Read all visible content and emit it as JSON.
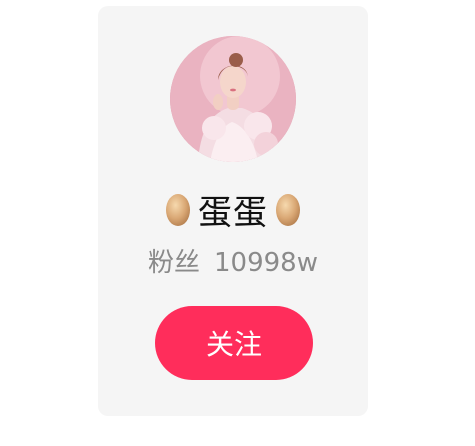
{
  "profile": {
    "name": "蛋蛋",
    "fans_label": "粉丝",
    "fans_count": "10998w",
    "avatar_icon": "user-avatar-photo",
    "name_decoration_icon": "egg-icon"
  },
  "actions": {
    "follow_label": "关注"
  },
  "colors": {
    "card_bg": "#f5f5f5",
    "follow_button": "#ff2d5b",
    "fans_text": "#8a8a8a"
  }
}
